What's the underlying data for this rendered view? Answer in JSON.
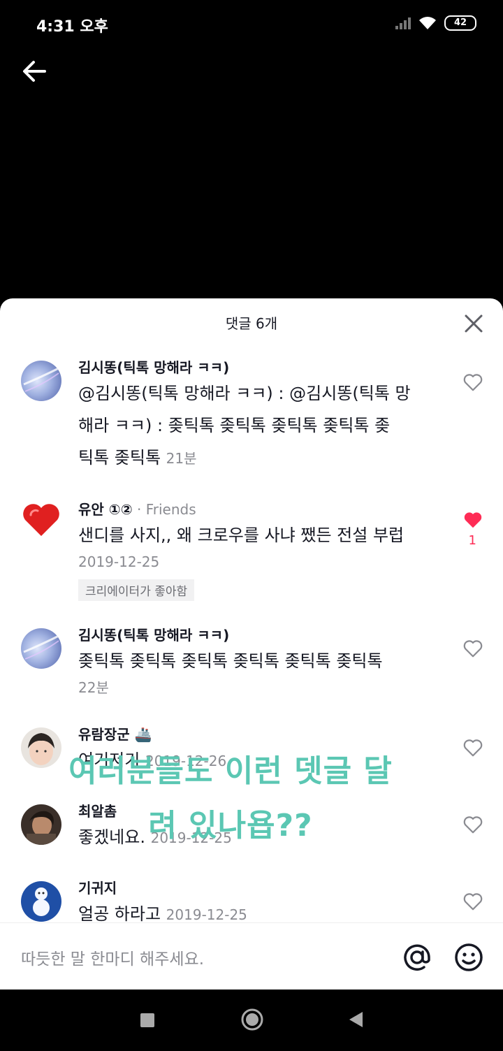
{
  "status": {
    "time": "4:31 오후",
    "battery": "42"
  },
  "sheet": {
    "title": "댓글 6개"
  },
  "comments": [
    {
      "username": "김시똥(틱톡 망해라 ㅋㅋ)",
      "lines": [
        "@김시똥(틱톡 망해라 ㅋㅋ) : @김시똥(틱톡 망",
        "해라 ㅋㅋ) : 좆틱톡 좆틱톡 좆틱톡 좆틱톡 좆",
        "틱톡 좆틱톡"
      ],
      "time": "21분"
    },
    {
      "username": "유안 ①②",
      "tag": " · Friends",
      "text": "샌디를 사지,, 왜 크로우를 사냐 쨌든 전설 부럽",
      "time": "2019-12-25",
      "badge": "크리에이터가 좋아함",
      "likes": "1"
    },
    {
      "username": "김시똥(틱톡 망해라 ㅋㅋ)",
      "text": "좆틱톡 좆틱톡 좆틱톡 좆틱톡 좆틱톡 좆틱톡",
      "time": "22분"
    },
    {
      "username": "유람장군 🚢",
      "text": "여기저기",
      "time": "2019-12-26"
    },
    {
      "username": "최알촘",
      "text": "좋겠네요.",
      "time": "2019-12-25"
    },
    {
      "username": "기귀지",
      "text": "얼공 하라고",
      "time": "2019-12-25"
    }
  ],
  "overlay": {
    "line1": "여러분들도 이런 뎃글 달",
    "line2": "려 있나욥??"
  },
  "input": {
    "placeholder": "따듯한 말 한마디 해주세요."
  },
  "icons": [
    "back-arrow-icon",
    "close-icon",
    "heart-outline-icon",
    "heart-filled-icon",
    "at-icon",
    "emoji-icon"
  ],
  "colors": {
    "like": "#fe2c55",
    "overlay_text": "#5bc7b3"
  }
}
